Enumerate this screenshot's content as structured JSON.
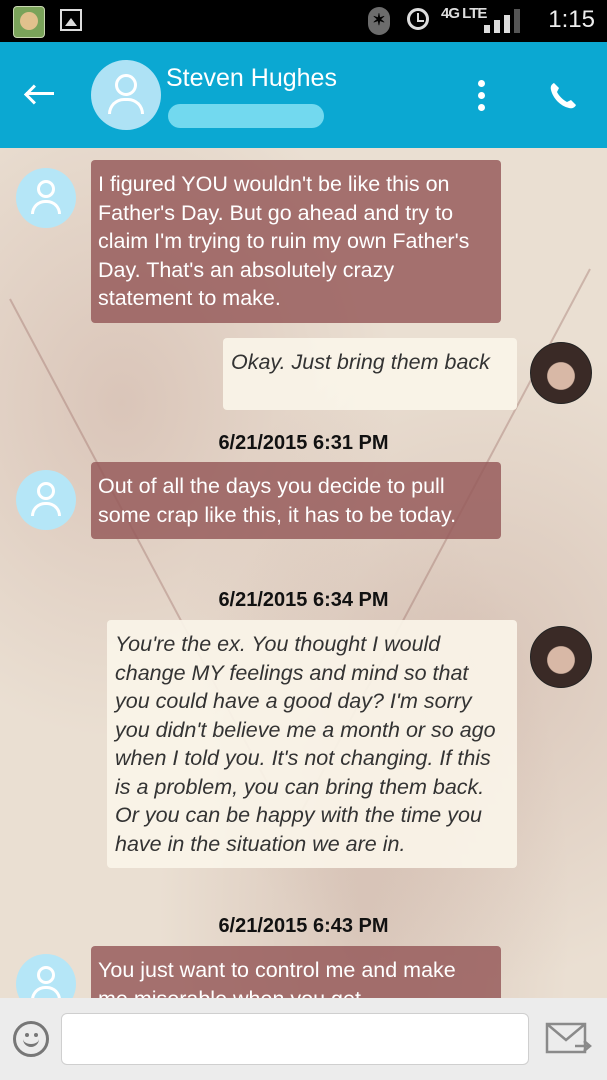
{
  "status_bar": {
    "network_label": "4G LTE",
    "time": "1:15"
  },
  "header": {
    "contact_name": "Steven Hughes",
    "back_icon": "arrow-left-icon",
    "menu_icon": "kebab-menu-icon",
    "call_icon": "phone-icon",
    "accent_color": "#0ba8d2"
  },
  "conversation": {
    "messages": [
      {
        "direction": "incoming",
        "text": "I figured YOU wouldn't be like this on Father's Day. But go ahead and try to claim I'm trying to ruin my own Father's Day. That's an absolutely crazy statement to make."
      },
      {
        "direction": "outgoing",
        "text": "Okay. Just bring them back"
      },
      {
        "timestamp": "6/21/2015 6:31 PM"
      },
      {
        "direction": "incoming",
        "text": "Out of all the days you decide to pull some crap like this, it has to be today."
      },
      {
        "timestamp": "6/21/2015 6:34 PM"
      },
      {
        "direction": "outgoing",
        "text": "You're the ex. You thought I would change MY feelings and mind so that you could have a good day? I'm sorry you didn't believe me a month or so ago when I told you. It's not changing. If this is a   problem, you can bring them back. Or you can be happy with the time you have in the situation we are in."
      },
      {
        "timestamp": "6/21/2015 6:43 PM"
      },
      {
        "direction": "incoming",
        "text": "You just want to control me and make me miserable when you get"
      }
    ]
  },
  "composer": {
    "placeholder": "",
    "emoji_icon": "smiley-icon",
    "send_icon": "envelope-send-icon"
  }
}
